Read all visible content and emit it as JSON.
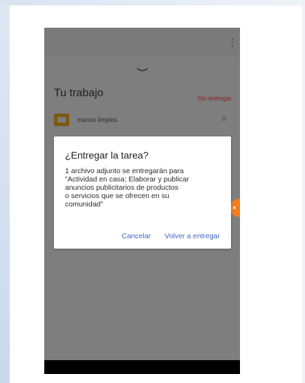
{
  "screen": {
    "work_title": "Tu trabajo",
    "status": "Sin entregar",
    "attachment": {
      "name": "manos limpios"
    }
  },
  "dialog": {
    "title": "¿Entregar la tarea?",
    "body": "1 archivo adjunto se entregarán para\n\"Actividad en casa:  Elaborar y publicar\nanuncios publicitarios de productos\no servicios que se ofrecen en su\ncomunidad\"",
    "cancel": "Cancelar",
    "confirm": "Volver a entregar"
  },
  "colors": {
    "accent": "#3b67c5",
    "status": "#8a1f1f",
    "orange": "#ef7d22"
  },
  "icons": {
    "menu": "more-vertical-icon",
    "handle": "chevron-down-icon",
    "doc": "document-icon",
    "remove": "close-icon"
  }
}
